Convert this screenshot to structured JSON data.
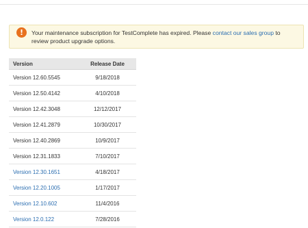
{
  "notice": {
    "icon": "exclamation-icon",
    "icon_glyph": "!",
    "icon_color": "#e8711e",
    "background_color": "#fcf8e3",
    "text_before": "Your maintenance subscription for TestComplete has expired. Please ",
    "link_text": "contact our sales group",
    "text_after": " to review product upgrade options."
  },
  "table": {
    "headers": {
      "version": "Version",
      "release_date": "Release Date"
    },
    "link_color": "#2a6db0",
    "rows": [
      {
        "version": "Version 12.60.5545",
        "release_date": "9/18/2018",
        "is_link": false
      },
      {
        "version": "Version 12.50.4142",
        "release_date": "4/10/2018",
        "is_link": false
      },
      {
        "version": "Version 12.42.3048",
        "release_date": "12/12/2017",
        "is_link": false
      },
      {
        "version": "Version 12.41.2879",
        "release_date": "10/30/2017",
        "is_link": false
      },
      {
        "version": "Version 12.40.2869",
        "release_date": "10/9/2017",
        "is_link": false
      },
      {
        "version": "Version 12.31.1833",
        "release_date": "7/10/2017",
        "is_link": false
      },
      {
        "version": "Version 12.30.1651",
        "release_date": "4/18/2017",
        "is_link": true
      },
      {
        "version": "Version 12.20.1005",
        "release_date": "1/17/2017",
        "is_link": true
      },
      {
        "version": "Version 12.10.602",
        "release_date": "11/4/2016",
        "is_link": true
      },
      {
        "version": "Version 12.0.122",
        "release_date": "7/28/2016",
        "is_link": true
      }
    ]
  }
}
